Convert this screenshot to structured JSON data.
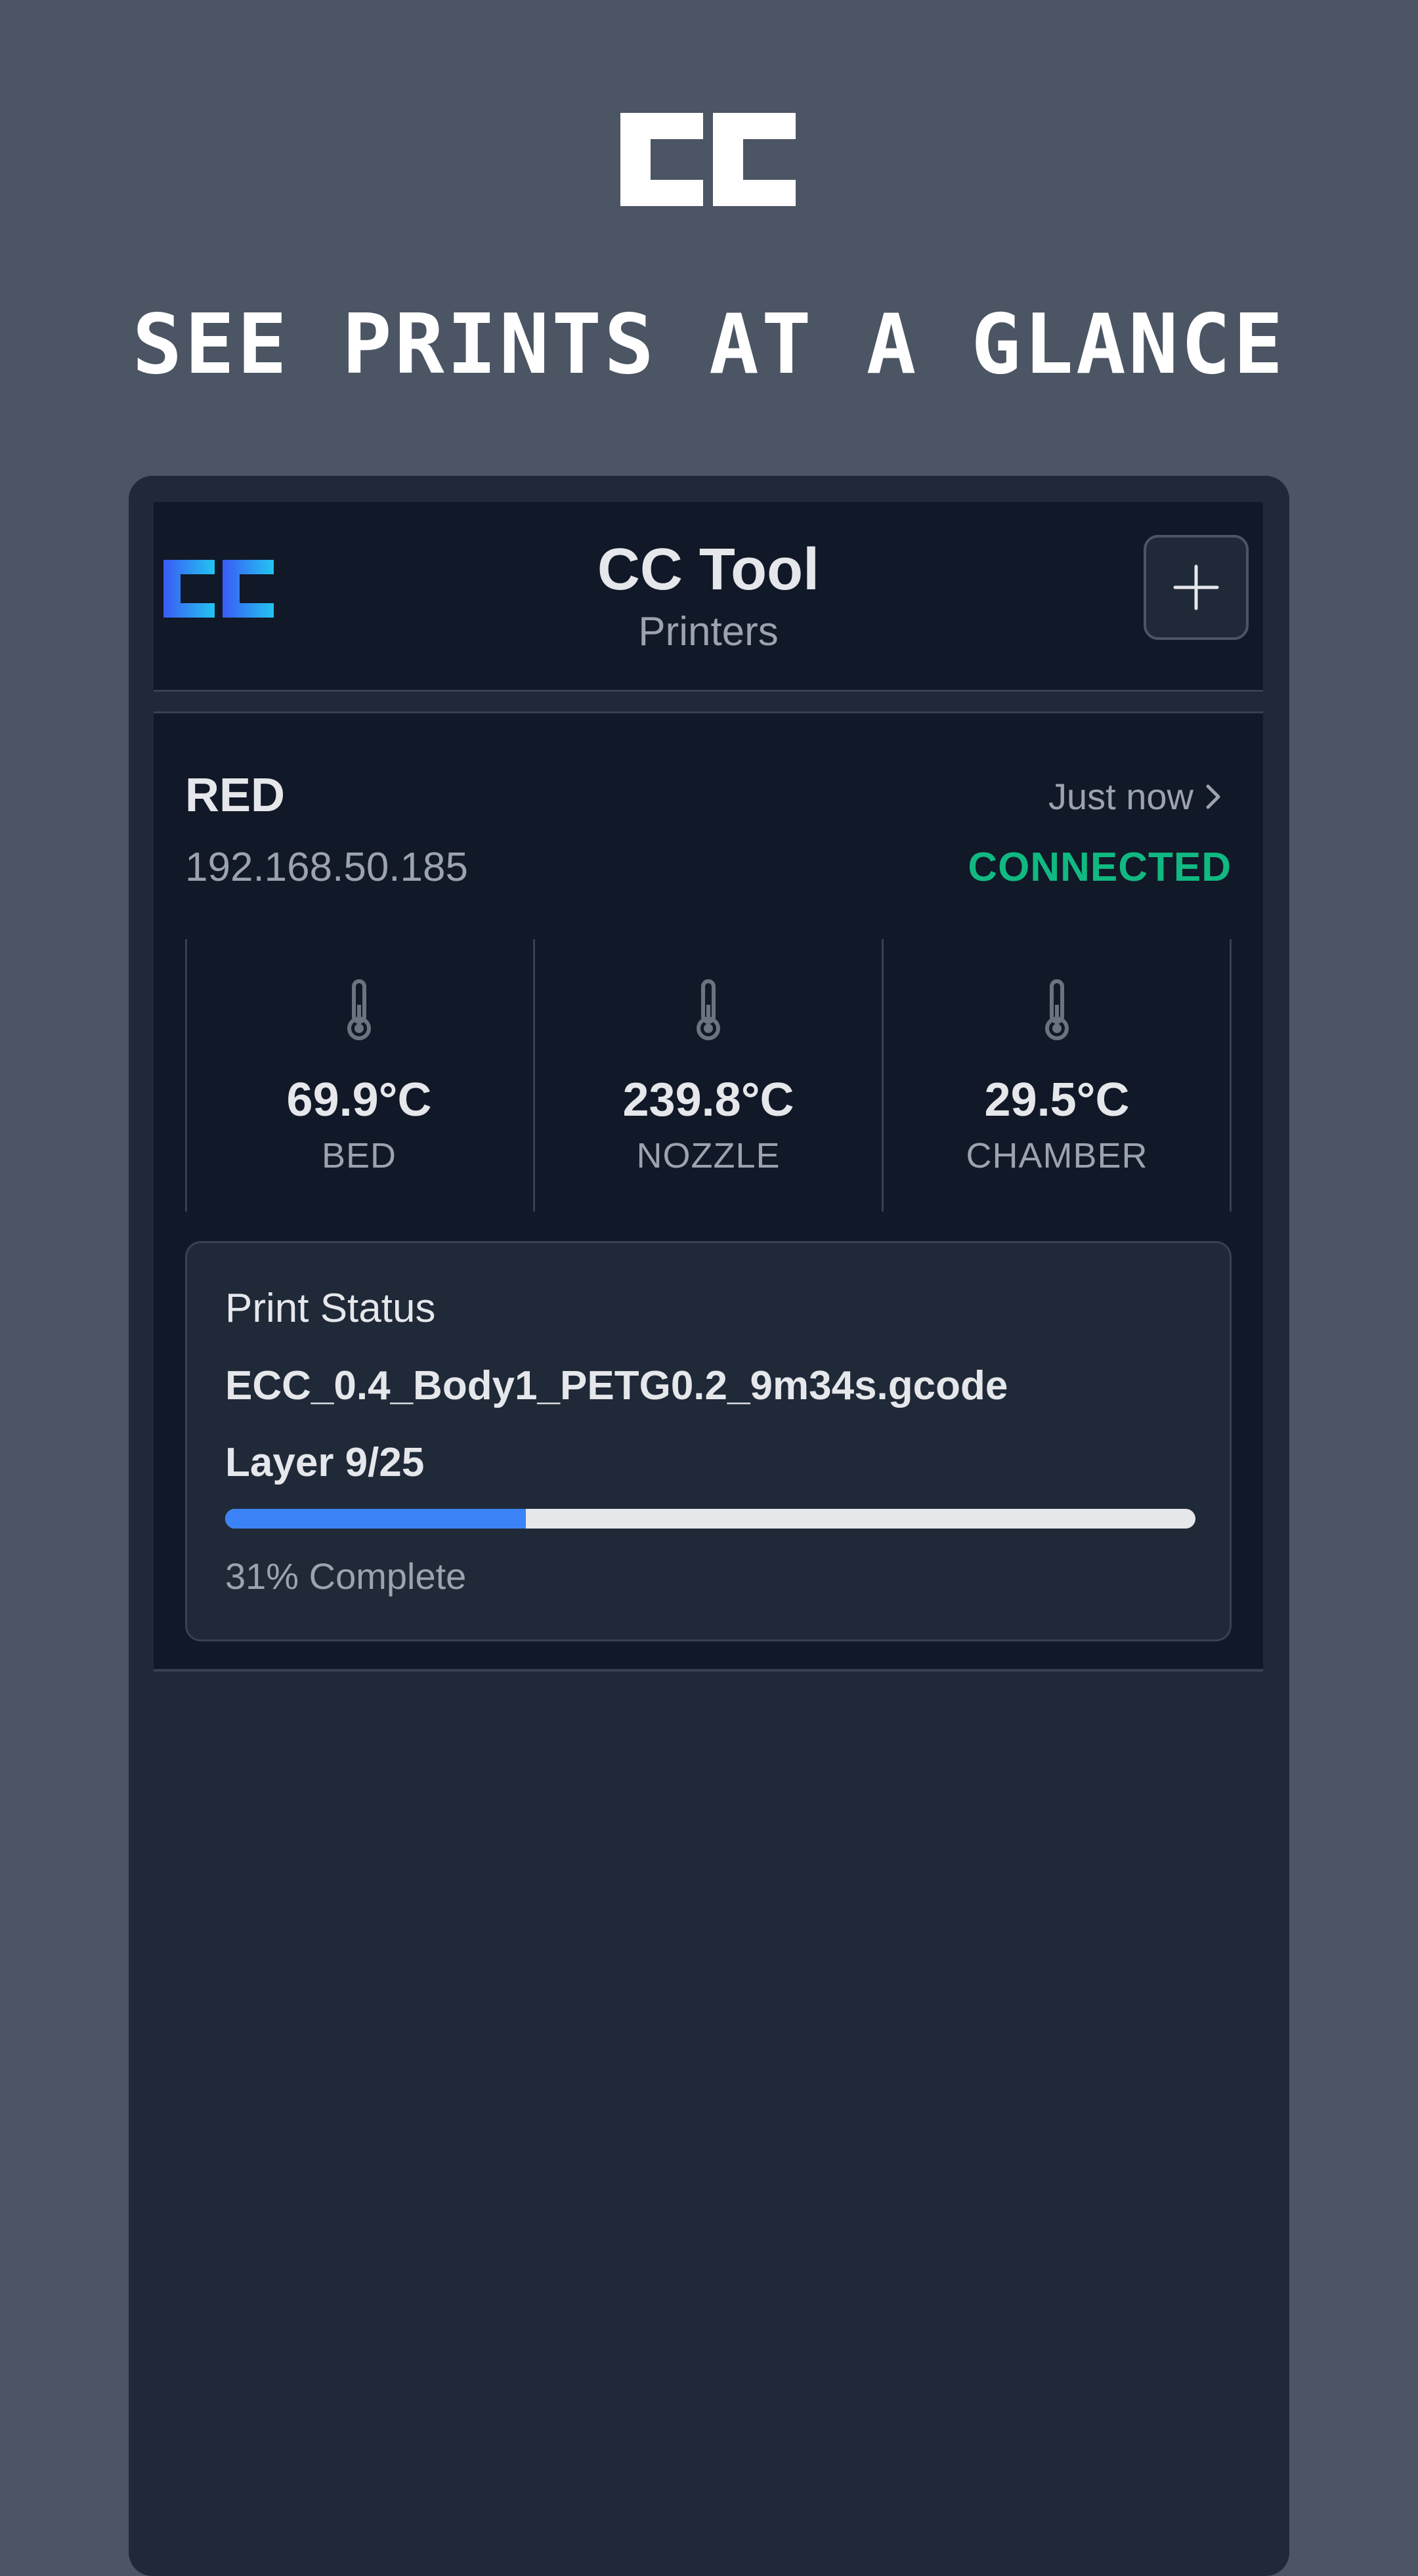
{
  "promo": {
    "logo_icon": "cc-logo",
    "headline": "SEE PRINTS AT A GLANCE"
  },
  "app": {
    "logo_icon": "cc-logo",
    "title": "CC Tool",
    "subtitle": "Printers",
    "add_icon": "plus-icon"
  },
  "printer": {
    "name": "RED",
    "ip": "192.168.50.185",
    "last_update": "Just now",
    "status": "CONNECTED",
    "temps": [
      {
        "value": "69.9°C",
        "label": "BED",
        "icon": "thermometer-icon"
      },
      {
        "value": "239.8°C",
        "label": "NOZZLE",
        "icon": "thermometer-icon"
      },
      {
        "value": "29.5°C",
        "label": "CHAMBER",
        "icon": "thermometer-icon"
      }
    ],
    "print_status": {
      "heading": "Print Status",
      "file": "ECC_0.4_Body1_PETG0.2_9m34s.gcode",
      "layer": "Layer 9/25",
      "progress": 0.31,
      "percent_text": "31% Complete"
    }
  },
  "colors": {
    "background": "#4b5563",
    "surface": "#111827",
    "panel": "#1f2937",
    "connected": "#10b981",
    "progress": "#3b82f6",
    "logo_gradient_start": "#3b5bf5",
    "logo_gradient_end": "#22c4f0"
  }
}
